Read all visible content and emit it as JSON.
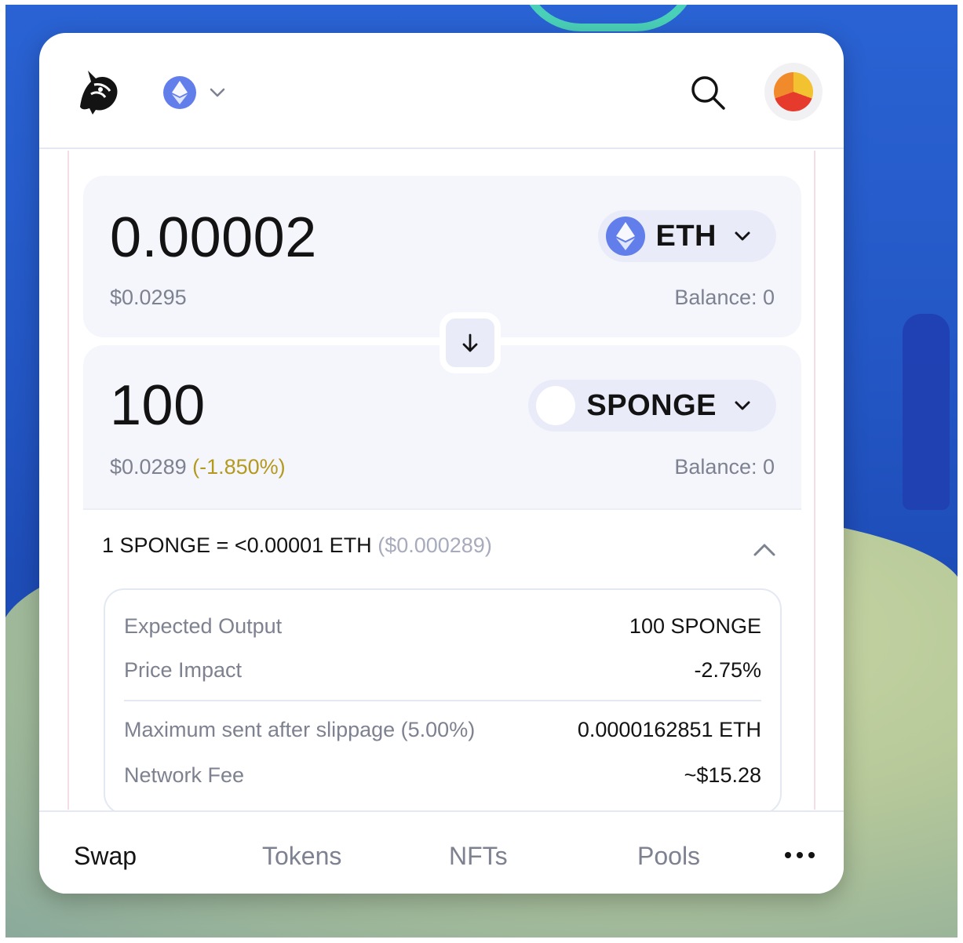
{
  "header": {
    "logo_icon": "unicorn-logo-icon",
    "chain_icon": "ethereum-icon",
    "search_icon": "search-icon",
    "avatar_icon": "wallet-avatar"
  },
  "swap": {
    "input": {
      "amount": "0.00002",
      "usd": "$0.0295",
      "balance": "Balance: 0",
      "token": "ETH"
    },
    "output": {
      "amount": "100",
      "usd": "$0.0289",
      "impact": "(-1.850%)",
      "balance": "Balance: 0",
      "token": "SPONGE"
    },
    "rate": {
      "text": "1 SPONGE = <0.00001 ETH",
      "usd": "($0.000289)"
    }
  },
  "details": [
    {
      "label": "Expected Output",
      "value": "100 SPONGE"
    },
    {
      "label": "Price Impact",
      "value": "-2.75%"
    },
    {
      "label": "Maximum sent after slippage (5.00%)",
      "value": "0.0000162851 ETH"
    },
    {
      "label": "Network Fee",
      "value": "~$15.28"
    }
  ],
  "tabs": [
    {
      "label": "Swap",
      "active": true
    },
    {
      "label": "Tokens",
      "active": false
    },
    {
      "label": "NFTs",
      "active": false
    },
    {
      "label": "Pools",
      "active": false
    }
  ],
  "colors": {
    "eth": "#627eea",
    "impact": "#b39a1e",
    "muted": "#7d8190",
    "panel": "#f5f6fc",
    "pill": "#e9ecf8"
  }
}
